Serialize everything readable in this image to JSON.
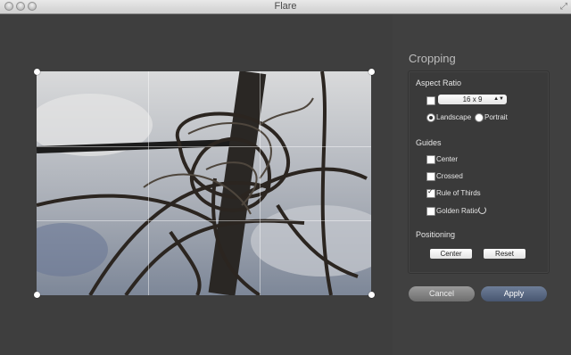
{
  "window": {
    "title": "Flare"
  },
  "panel": {
    "title": "Cropping",
    "aspect": {
      "heading": "Aspect Ratio",
      "ratio_value": "16 x 9",
      "landscape_label": "Landscape",
      "portrait_label": "Portrait",
      "orientation": "Landscape"
    },
    "guides": {
      "heading": "Guides",
      "items": [
        {
          "label": "Center",
          "checked": false
        },
        {
          "label": "Crossed",
          "checked": false
        },
        {
          "label": "Rule of Thirds",
          "checked": true
        },
        {
          "label": "Golden Ratio",
          "checked": false
        }
      ]
    },
    "positioning": {
      "heading": "Positioning",
      "center_label": "Center",
      "reset_label": "Reset"
    }
  },
  "actions": {
    "cancel_label": "Cancel",
    "apply_label": "Apply"
  }
}
